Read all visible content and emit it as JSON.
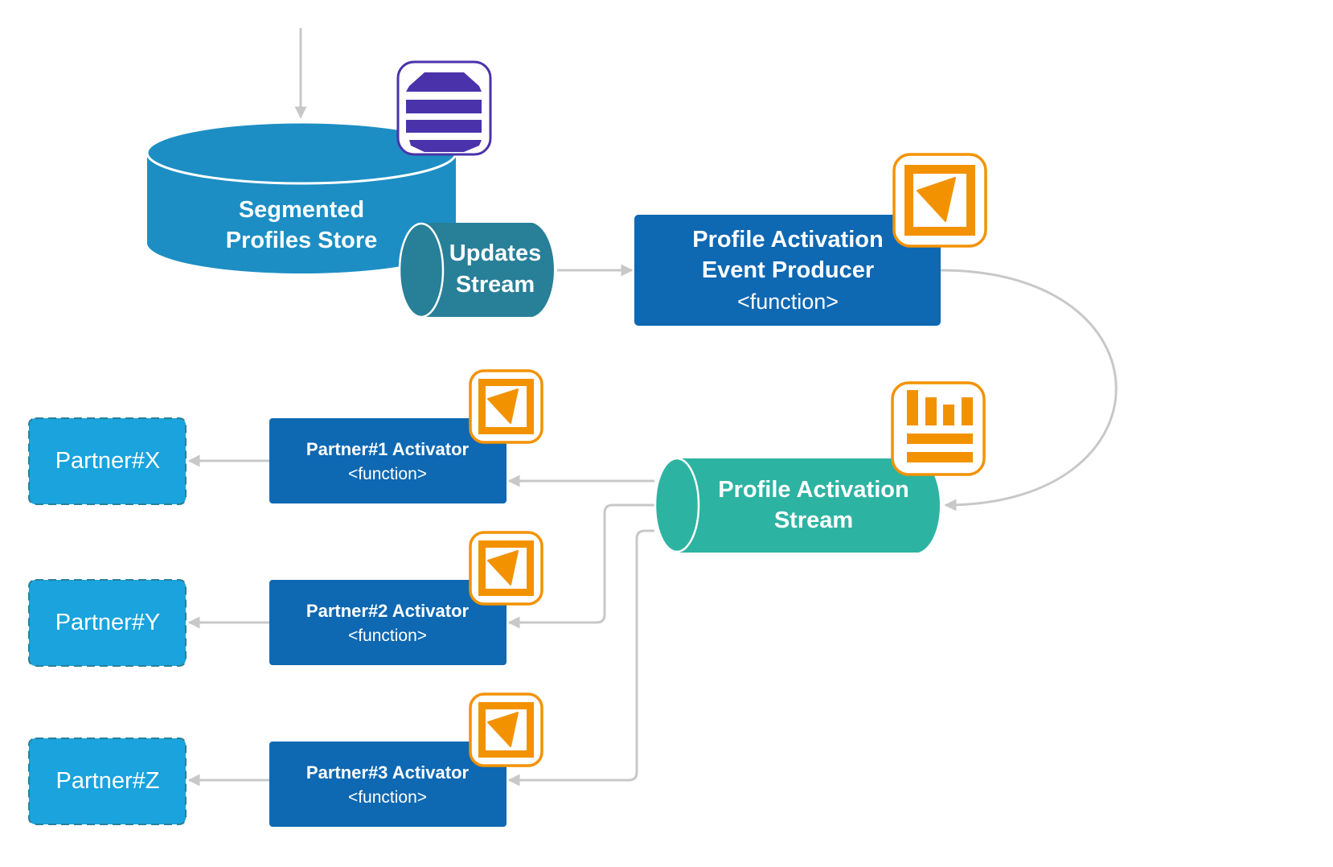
{
  "diagram": {
    "colors": {
      "connector": "#c8c8c8",
      "store": "#1c8ec4",
      "updates_stream": "#287f98",
      "function_box": "#0e68b2",
      "activation_stream": "#2db3a2",
      "partner": "#1aa3dd",
      "partner_border": "#2a7f99",
      "icon_orange": "#f39200",
      "icon_purple": "#4a33aa"
    },
    "nodes": {
      "store": {
        "line1": "Segmented",
        "line2": "Profiles Store",
        "icon": "database-stack-icon"
      },
      "updates_stream": {
        "line1": "Updates",
        "line2": "Stream"
      },
      "producer": {
        "line1": "Profile Activation",
        "line2": "Event Producer",
        "line3": "<function>",
        "icon": "function-icon"
      },
      "activation_stream": {
        "line1": "Profile Activation",
        "line2": "Stream",
        "icon": "stream-analytics-icon"
      },
      "activators": [
        {
          "title": "Partner#1 Activator",
          "subtitle": "<function>",
          "icon": "function-icon"
        },
        {
          "title": "Partner#2 Activator",
          "subtitle": "<function>",
          "icon": "function-icon"
        },
        {
          "title": "Partner#3 Activator",
          "subtitle": "<function>",
          "icon": "function-icon"
        }
      ],
      "partners": [
        {
          "label": "Partner#X"
        },
        {
          "label": "Partner#Y"
        },
        {
          "label": "Partner#Z"
        }
      ]
    },
    "edges": [
      {
        "from": "external-input",
        "to": "store"
      },
      {
        "from": "updates_stream",
        "to": "producer"
      },
      {
        "from": "producer",
        "to": "activation_stream"
      },
      {
        "from": "activation_stream",
        "to": "activator-1"
      },
      {
        "from": "activation_stream",
        "to": "activator-2"
      },
      {
        "from": "activation_stream",
        "to": "activator-3"
      },
      {
        "from": "activator-1",
        "to": "partner-x"
      },
      {
        "from": "activator-2",
        "to": "partner-y"
      },
      {
        "from": "activator-3",
        "to": "partner-z"
      }
    ]
  }
}
